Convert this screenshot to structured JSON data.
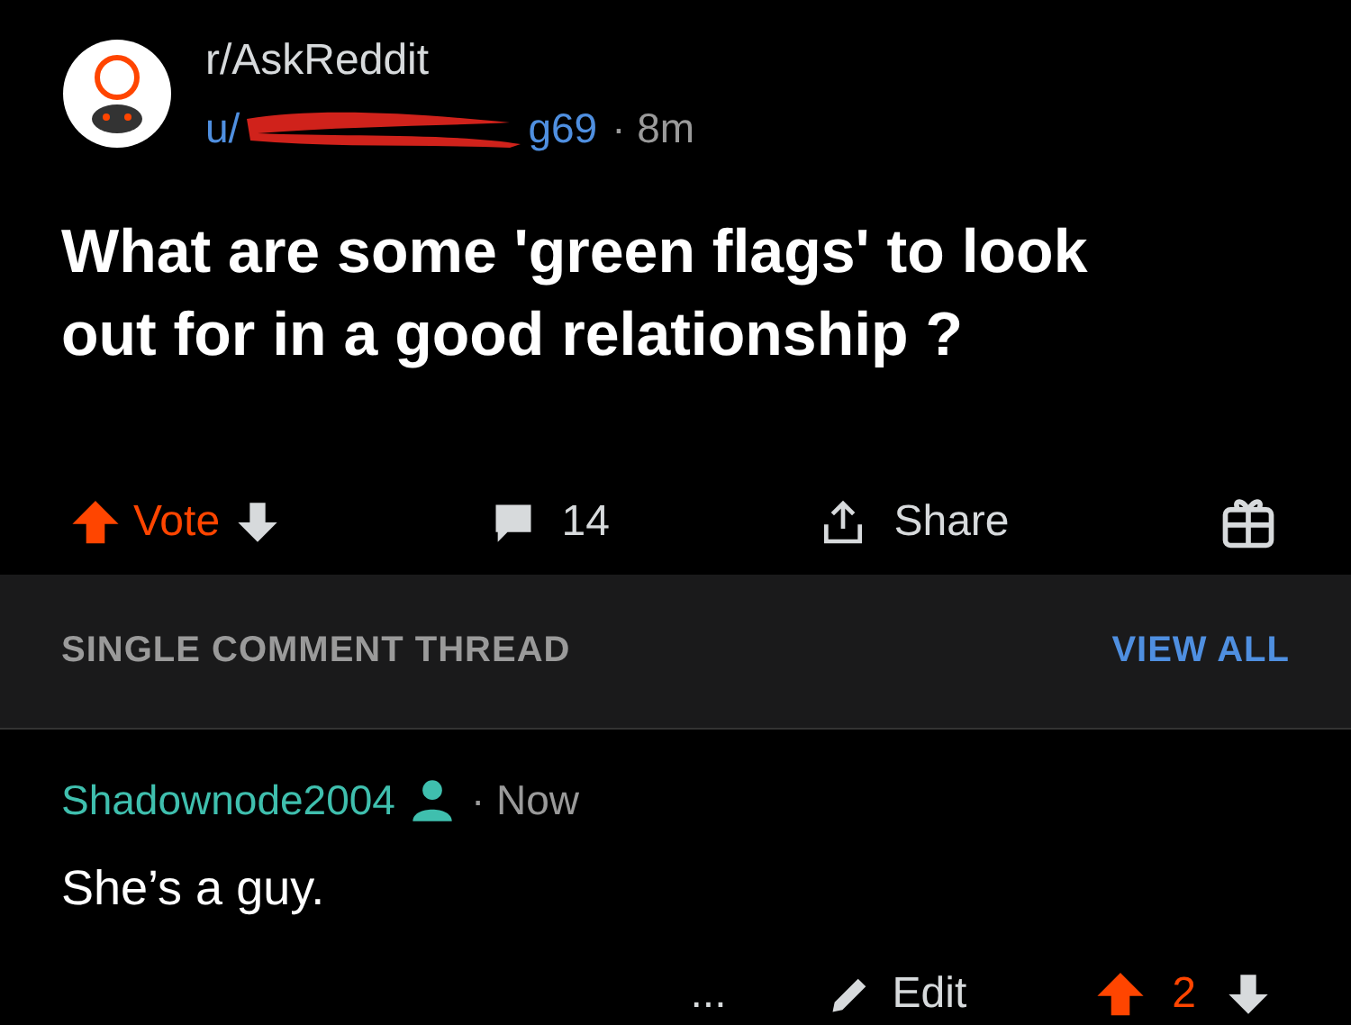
{
  "post": {
    "subreddit": "r/AskReddit",
    "user_prefix": "u/",
    "user_suffix": "g69",
    "redacted": true,
    "separator": "·",
    "time": "8m",
    "title": "What are some 'green flags' to look out for in a good relationship ?",
    "vote_label": "Vote",
    "upvoted": true,
    "comments": "14",
    "share": "Share"
  },
  "thread": {
    "label": "SINGLE COMMENT THREAD",
    "view_all": "VIEW ALL"
  },
  "comment": {
    "author": "Shadownode2004",
    "separator": "·",
    "time": "Now",
    "body": "She’s a guy.",
    "more": "...",
    "edit": "Edit",
    "score": "2",
    "upvoted": true
  }
}
